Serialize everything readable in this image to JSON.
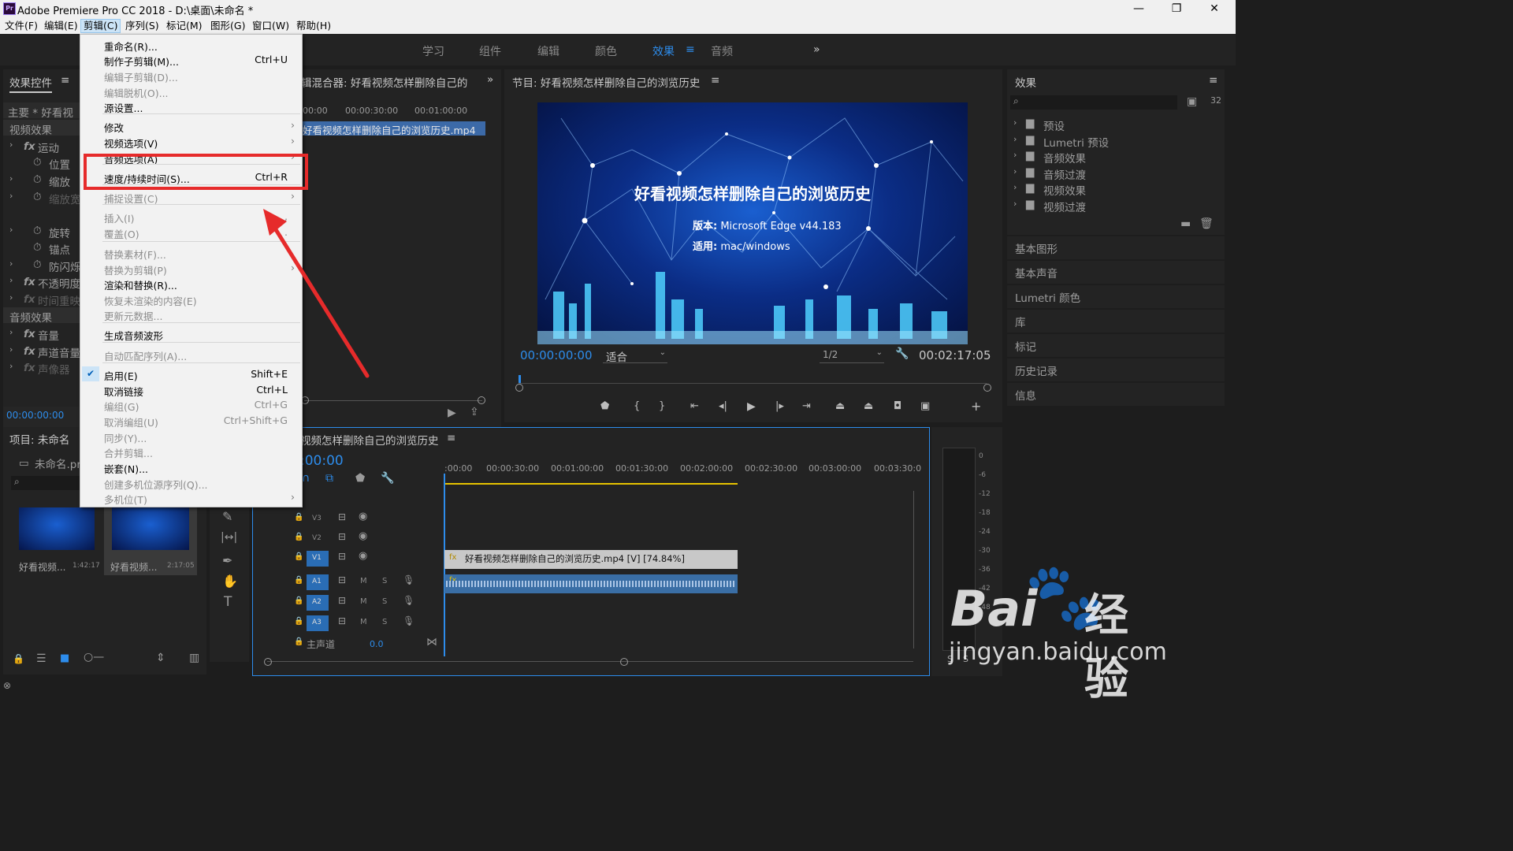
{
  "window": {
    "title": "Adobe Premiere Pro CC 2018 - D:\\桌面\\未命名 *",
    "app_icon_text": "Pr",
    "controls": {
      "minimize": "—",
      "maximize": "❐",
      "close": "✕"
    }
  },
  "menubar": {
    "items": [
      "文件(F)",
      "编辑(E)",
      "剪辑(C)",
      "序列(S)",
      "标记(M)",
      "图形(G)",
      "窗口(W)",
      "帮助(H)"
    ],
    "active": "剪辑(C)"
  },
  "workspaces": {
    "tabs": [
      "学习",
      "组件",
      "编辑",
      "颜色",
      "效果",
      "音频"
    ],
    "active": "效果",
    "more": "»"
  },
  "clip_menu": {
    "items": [
      {
        "label": "重命名(R)...",
        "shortcut": "",
        "enabled": true
      },
      {
        "label": "制作子剪辑(M)...",
        "shortcut": "Ctrl+U",
        "enabled": true
      },
      {
        "label": "编辑子剪辑(D)...",
        "shortcut": "",
        "enabled": false
      },
      {
        "label": "编辑脱机(O)...",
        "shortcut": "",
        "enabled": false
      },
      {
        "label": "源设置...",
        "shortcut": "",
        "enabled": true
      },
      {
        "label": "修改",
        "shortcut": "",
        "enabled": true,
        "submenu": true
      },
      {
        "label": "视频选项(V)",
        "shortcut": "",
        "enabled": true,
        "submenu": true
      },
      {
        "label": "音频选项(A)",
        "shortcut": "",
        "enabled": true,
        "submenu": true
      },
      {
        "label": "速度/持续时间(S)...",
        "shortcut": "Ctrl+R",
        "enabled": true
      },
      {
        "label": "捕捉设置(C)",
        "shortcut": "",
        "enabled": false,
        "submenu": true
      },
      {
        "label": "插入(I)",
        "shortcut": ",",
        "enabled": false
      },
      {
        "label": "覆盖(O)",
        "shortcut": ".",
        "enabled": false
      },
      {
        "label": "替换素材(F)...",
        "shortcut": "",
        "enabled": false
      },
      {
        "label": "替换为剪辑(P)",
        "shortcut": "",
        "enabled": false,
        "submenu": true
      },
      {
        "label": "渲染和替换(R)...",
        "shortcut": "",
        "enabled": true
      },
      {
        "label": "恢复未渲染的内容(E)",
        "shortcut": "",
        "enabled": false
      },
      {
        "label": "更新元数据...",
        "shortcut": "",
        "enabled": false
      },
      {
        "label": "生成音频波形",
        "shortcut": "",
        "enabled": true
      },
      {
        "label": "自动匹配序列(A)...",
        "shortcut": "",
        "enabled": false
      },
      {
        "label": "启用(E)",
        "shortcut": "Shift+E",
        "enabled": true,
        "checked": true
      },
      {
        "label": "取消链接",
        "shortcut": "Ctrl+L",
        "enabled": true
      },
      {
        "label": "编组(G)",
        "shortcut": "Ctrl+G",
        "enabled": false
      },
      {
        "label": "取消编组(U)",
        "shortcut": "Ctrl+Shift+G",
        "enabled": false
      },
      {
        "label": "同步(Y)...",
        "shortcut": "",
        "enabled": false
      },
      {
        "label": "合并剪辑...",
        "shortcut": "",
        "enabled": false
      },
      {
        "label": "嵌套(N)...",
        "shortcut": "",
        "enabled": true
      },
      {
        "label": "创建多机位源序列(Q)...",
        "shortcut": "",
        "enabled": false
      },
      {
        "label": "多机位(T)",
        "shortcut": "",
        "enabled": false,
        "submenu": true
      }
    ]
  },
  "effect_controls": {
    "title": "效果控件",
    "menu_icon": "≡",
    "source": "主要 * 好看视频",
    "video_section": "视频效果",
    "video_rows": [
      "运动",
      "位置",
      "缩放",
      "缩放宽",
      "旋转",
      "锚点",
      "防闪烁",
      "不透明度",
      "时间重映"
    ],
    "audio_section": "音频效果",
    "audio_rows": [
      "音量",
      "声道音量",
      "声像器"
    ],
    "timecode": "00:00:00:00",
    "fx_label": "fx"
  },
  "audio_mixer": {
    "title": "辑混合器: 好看视频怎样删除自己的",
    "ruler": [
      "00:00",
      "00:00:30:00",
      "00:01:00:00"
    ],
    "clip": "好看视频怎样删除自己的浏览历史.mp4"
  },
  "program_monitor": {
    "title": "节目: 好看视频怎样删除自己的浏览历史",
    "menu_icon": "≡",
    "video_title": "好看视频怎样删除自己的浏览历史",
    "version_label": "版本:",
    "version_value": "Microsoft Edge  v44.183",
    "platform_label": "适用:",
    "platform_value": "mac/windows",
    "timecode": "00:00:00:00",
    "fit": "适合",
    "resolution": "1/2",
    "duration": "00:02:17:05"
  },
  "effects_panel": {
    "title": "效果",
    "menu_icon": "≡",
    "folders": [
      "预设",
      "Lumetri 预设",
      "音频效果",
      "音频过渡",
      "视频效果",
      "视频过渡"
    ],
    "sections": [
      "基本图形",
      "基本声音",
      "Lumetri 颜色",
      "库",
      "标记",
      "历史记录",
      "信息"
    ]
  },
  "project_panel": {
    "title": "项目: 未命名",
    "file": "未命名.prp",
    "items": [
      {
        "name": "好看视频...",
        "duration": "1:42:17"
      },
      {
        "name": "好看视频...",
        "duration": "2:17:05"
      }
    ]
  },
  "timeline": {
    "title": "视频怎样删除自己的浏览历史",
    "menu_icon": "≡",
    "timecode": ":00:00",
    "ruler": [
      ":00:00",
      "00:00:30:00",
      "00:01:00:00",
      "00:01:30:00",
      "00:02:00:00",
      "00:02:30:00",
      "00:03:00:00",
      "00:03:30:0"
    ],
    "tracks": [
      {
        "name": "V3",
        "m": "",
        "s": ""
      },
      {
        "name": "V2",
        "m": "",
        "s": ""
      },
      {
        "name": "V1",
        "m": "",
        "s": ""
      },
      {
        "name": "A1",
        "m": "M",
        "s": "S"
      },
      {
        "name": "A2",
        "m": "M",
        "s": "S"
      },
      {
        "name": "A3",
        "m": "M",
        "s": "S"
      }
    ],
    "master_label": "主声道",
    "master_value": "0.0",
    "video_clip": "好看视频怎样删除自己的浏览历史.mp4 [V] [74.84%]",
    "audio_meter_ticks": [
      "0",
      "-6",
      "-12",
      "-18",
      "-24",
      "-30",
      "-36",
      "-42",
      "-48"
    ],
    "solo_labels": [
      "S",
      "S"
    ]
  },
  "watermark": {
    "brand": "Bai",
    "paw": "🐾",
    "cn": "经验",
    "url": "jingyan.baidu.com"
  },
  "colors": {
    "accent": "#2d8ceb",
    "highlight": "#e62b2b",
    "clip_video": "#c8c8c8",
    "clip_audio": "#3a6ea5",
    "work_area": "#e6c200"
  }
}
